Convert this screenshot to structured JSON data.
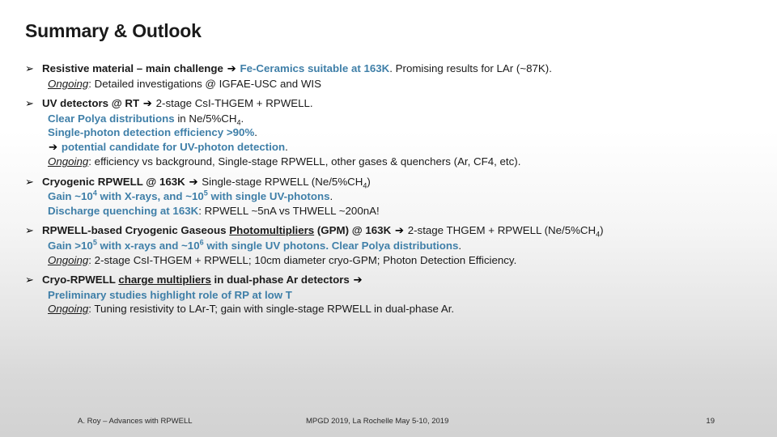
{
  "slide": {
    "title": "Summary & Outlook",
    "bullet_marker": "➢",
    "arrow_glyph": "➔",
    "accent_color": "#3f7fa8",
    "text_color": "#1a1a1a",
    "background_top": "#ffffff",
    "background_bottom": "#d2d2d2"
  },
  "blocks": [
    {
      "id": "resistive-material",
      "lines": [
        {
          "id": "resistive-material-head",
          "segments": [
            {
              "text": "Resistive material – main challenge ",
              "style": "bold"
            },
            {
              "text": "➔",
              "style": "arrow"
            },
            {
              "text": " Fe-Ceramics suitable at 163K",
              "style": "blue-bold"
            },
            {
              "text": ". Promising results for LAr (~87K).",
              "style": "regular"
            }
          ]
        },
        {
          "id": "resistive-material-ongoing",
          "segments": [
            {
              "text": "Ongoing",
              "style": "ongoing"
            },
            {
              "text": ": Detailed investigations @ IGFAE-USC and WIS",
              "style": "regular"
            }
          ]
        }
      ]
    },
    {
      "id": "uv-detectors",
      "lines": [
        {
          "id": "uv-detectors-head",
          "segments": [
            {
              "text": "UV detectors @ RT ",
              "style": "bold"
            },
            {
              "text": "➔",
              "style": "arrow"
            },
            {
              "text": " 2-stage CsI-THGEM + RPWELL.",
              "style": "regular"
            }
          ]
        },
        {
          "id": "uv-detectors-polya",
          "segments": [
            {
              "text": "Clear Polya distributions",
              "style": "blue-bold"
            },
            {
              "text": " in Ne/5%CH",
              "style": "regular"
            },
            {
              "text": "4",
              "style": "subscript"
            },
            {
              "text": ".",
              "style": "regular"
            }
          ]
        },
        {
          "id": "uv-detectors-efficiency",
          "segments": [
            {
              "text": "Single-photon detection efficiency >90%",
              "style": "blue-bold"
            },
            {
              "text": ".",
              "style": "regular"
            }
          ]
        },
        {
          "id": "uv-detectors-candidate",
          "segments": [
            {
              "text": "➔",
              "style": "arrow"
            },
            {
              "text": " potential candidate for UV-photon detection",
              "style": "blue-bold"
            },
            {
              "text": ".",
              "style": "regular"
            }
          ]
        },
        {
          "id": "uv-detectors-ongoing",
          "segments": [
            {
              "text": "Ongoing",
              "style": "ongoing"
            },
            {
              "text": ": efficiency vs background, Single-stage RPWELL, other gases & quenchers (Ar, CF4, etc).",
              "style": "regular"
            }
          ]
        }
      ]
    },
    {
      "id": "cryogenic-rpwell",
      "lines": [
        {
          "id": "cryogenic-rpwell-head",
          "segments": [
            {
              "text": "Cryogenic RPWELL @ 163K ",
              "style": "bold"
            },
            {
              "text": "➔",
              "style": "arrow"
            },
            {
              "text": " Single-stage RPWELL (Ne/5%CH",
              "style": "regular"
            },
            {
              "text": "4",
              "style": "subscript"
            },
            {
              "text": ")",
              "style": "regular"
            }
          ]
        },
        {
          "id": "cryogenic-rpwell-gain",
          "segments": [
            {
              "text": "Gain ~10",
              "style": "blue-bold"
            },
            {
              "text": "4",
              "style": "superscript-blue-bold"
            },
            {
              "text": " with X-rays, and ~10",
              "style": "blue-bold"
            },
            {
              "text": "5",
              "style": "superscript-blue-bold"
            },
            {
              "text": " with single UV-photons",
              "style": "blue-bold"
            },
            {
              "text": ".",
              "style": "regular"
            }
          ]
        },
        {
          "id": "cryogenic-rpwell-discharge",
          "segments": [
            {
              "text": "Discharge quenching at 163K",
              "style": "blue-bold"
            },
            {
              "text": ": RPWELL ~5nA vs THWELL ~200nA!",
              "style": "regular"
            }
          ]
        }
      ]
    },
    {
      "id": "gpm",
      "lines": [
        {
          "id": "gpm-head",
          "segments": [
            {
              "text": "RPWELL-based Cryogenic Gaseous ",
              "style": "bold"
            },
            {
              "text": "Photomultipliers",
              "style": "bold-underline"
            },
            {
              "text": " (GPM) @ 163K ",
              "style": "bold"
            },
            {
              "text": "➔",
              "style": "arrow"
            },
            {
              "text": " 2-stage THGEM + RPWELL (Ne/5%CH",
              "style": "regular"
            },
            {
              "text": "4",
              "style": "subscript"
            },
            {
              "text": ")",
              "style": "regular"
            }
          ]
        },
        {
          "id": "gpm-gain",
          "segments": [
            {
              "text": "Gain >10",
              "style": "blue-bold"
            },
            {
              "text": "5",
              "style": "superscript-blue-bold"
            },
            {
              "text": " with x-rays and ~10",
              "style": "blue-bold"
            },
            {
              "text": "6",
              "style": "superscript-blue-bold"
            },
            {
              "text": " with single UV photons. Clear Polya distributions",
              "style": "blue-bold"
            },
            {
              "text": ".",
              "style": "regular"
            }
          ]
        },
        {
          "id": "gpm-ongoing",
          "segments": [
            {
              "text": "Ongoing",
              "style": "ongoing"
            },
            {
              "text": ": 2-stage CsI-THGEM + RPWELL; 10cm diameter cryo-GPM; Photon Detection Efficiency.",
              "style": "regular"
            }
          ]
        }
      ]
    },
    {
      "id": "cryo-rpwell-dualphase",
      "lines": [
        {
          "id": "cryo-rpwell-dualphase-head",
          "segments": [
            {
              "text": "Cryo-RPWELL ",
              "style": "bold"
            },
            {
              "text": "charge multipliers",
              "style": "bold-underline"
            },
            {
              "text": " in dual-phase Ar detectors ",
              "style": "bold"
            },
            {
              "text": "➔",
              "style": "arrow"
            }
          ]
        },
        {
          "id": "cryo-rpwell-dualphase-prelim",
          "segments": [
            {
              "text": "Preliminary studies highlight role of RP at low T",
              "style": "blue-bold"
            }
          ]
        },
        {
          "id": "cryo-rpwell-dualphase-ongoing",
          "segments": [
            {
              "text": "Ongoing",
              "style": "ongoing"
            },
            {
              "text": ": Tuning resistivity to LAr-T; gain with single-stage RPWELL in dual-phase Ar.",
              "style": "regular"
            }
          ]
        }
      ]
    }
  ],
  "footer": {
    "left": "A. Roy – Advances with RPWELL",
    "center": "MPGD 2019, La Rochelle May 5-10, 2019",
    "page_number": "19"
  }
}
